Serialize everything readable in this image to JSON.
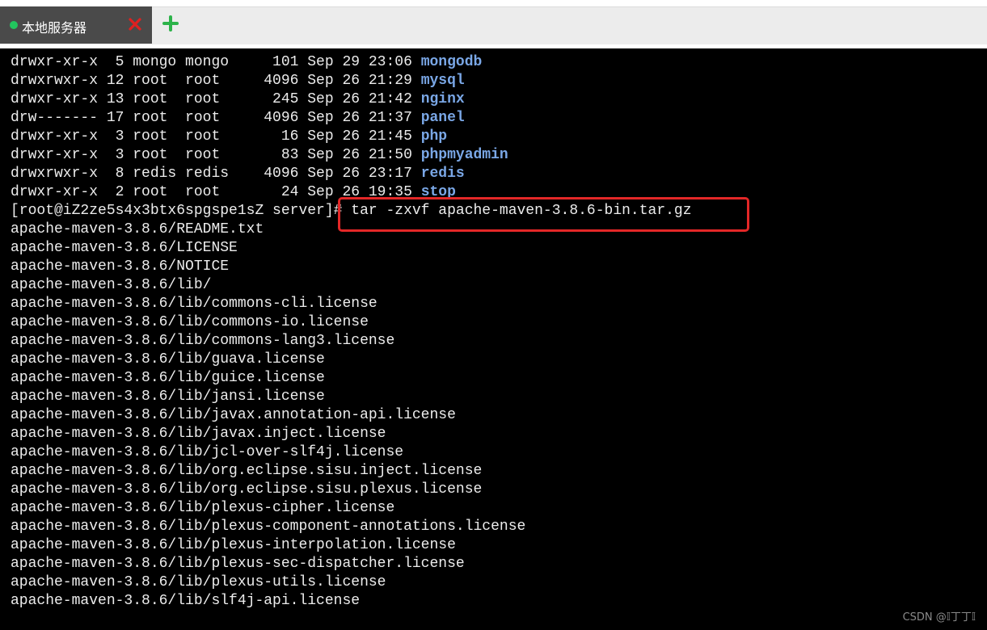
{
  "tab": {
    "label": "本地服务器",
    "status_color": "#22c55e",
    "close_icon": "close-icon",
    "add_icon": "plus-icon"
  },
  "terminal": {
    "listing": [
      {
        "perms": "drwxr-xr-x  5 mongo mongo     101 Sep 29 23:06 ",
        "name": "mongodb"
      },
      {
        "perms": "drwxrwxr-x 12 root  root     4096 Sep 26 21:29 ",
        "name": "mysql"
      },
      {
        "perms": "drwxr-xr-x 13 root  root      245 Sep 26 21:42 ",
        "name": "nginx"
      },
      {
        "perms": "drw------- 17 root  root     4096 Sep 26 21:37 ",
        "name": "panel"
      },
      {
        "perms": "drwxr-xr-x  3 root  root       16 Sep 26 21:45 ",
        "name": "php"
      },
      {
        "perms": "drwxr-xr-x  3 root  root       83 Sep 26 21:50 ",
        "name": "phpmyadmin"
      },
      {
        "perms": "drwxrwxr-x  8 redis redis    4096 Sep 26 23:17 ",
        "name": "redis"
      },
      {
        "perms": "drwxr-xr-x  2 root  root       24 Sep 26 19:35 ",
        "name": "stop"
      }
    ],
    "prompt": "[root@iZ2ze5s4x3btx6spgspe1sZ server]# tar -zxvf apache-maven-3.8.6-bin.tar.gz",
    "output": [
      "apache-maven-3.8.6/README.txt",
      "apache-maven-3.8.6/LICENSE",
      "apache-maven-3.8.6/NOTICE",
      "apache-maven-3.8.6/lib/",
      "apache-maven-3.8.6/lib/commons-cli.license",
      "apache-maven-3.8.6/lib/commons-io.license",
      "apache-maven-3.8.6/lib/commons-lang3.license",
      "apache-maven-3.8.6/lib/guava.license",
      "apache-maven-3.8.6/lib/guice.license",
      "apache-maven-3.8.6/lib/jansi.license",
      "apache-maven-3.8.6/lib/javax.annotation-api.license",
      "apache-maven-3.8.6/lib/javax.inject.license",
      "apache-maven-3.8.6/lib/jcl-over-slf4j.license",
      "apache-maven-3.8.6/lib/org.eclipse.sisu.inject.license",
      "apache-maven-3.8.6/lib/org.eclipse.sisu.plexus.license",
      "apache-maven-3.8.6/lib/plexus-cipher.license",
      "apache-maven-3.8.6/lib/plexus-component-annotations.license",
      "apache-maven-3.8.6/lib/plexus-interpolation.license",
      "apache-maven-3.8.6/lib/plexus-sec-dispatcher.license",
      "apache-maven-3.8.6/lib/plexus-utils.license",
      "apache-maven-3.8.6/lib/slf4j-api.license"
    ]
  },
  "colors": {
    "directory": "#7aa7e6",
    "highlight": "#e32727",
    "add_icon": "#2db34a",
    "close_icon": "#e02020"
  },
  "watermark": "CSDN @𝕀丁丁𝕀"
}
